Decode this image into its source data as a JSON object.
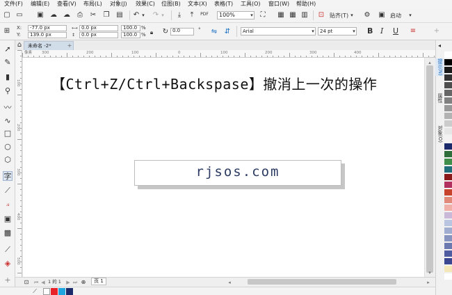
{
  "menubar": {
    "items": [
      "文件(F)",
      "编辑(E)",
      "查看(V)",
      "布局(L)",
      "对象(J)",
      "效果(C)",
      "位图(B)",
      "文本(X)",
      "表格(T)",
      "工具(O)",
      "窗口(W)",
      "帮助(H)"
    ]
  },
  "toolbar": {
    "zoom_value": "100%",
    "snap_label": "贴齐(T)",
    "launch_label": "启动"
  },
  "propbar": {
    "x_label": "X:",
    "x_value": "-77.0 px",
    "y_label": "Y:",
    "y_value": "139.0 px",
    "w_value": "0.0 px",
    "h_value": "0.0 px",
    "scale_w": "100.0",
    "scale_h": "100.0",
    "percent": "%",
    "rotation": "0.0",
    "degree": "°",
    "font_name": "Arial",
    "font_size": "24 pt",
    "bold": "B",
    "italic": "I",
    "underline": "U"
  },
  "document": {
    "tab_label": "未命名 -2*",
    "text_line": "【Ctrl+Z/Ctrl+Backspase】撤消上一次的操作",
    "box_text": "rjsos.com",
    "page_tab": "页 1",
    "page_counter": "1 的 1"
  },
  "ruler": {
    "units": "像素",
    "h_labels": [
      "300",
      "200",
      "100",
      "0",
      "100",
      "200",
      "300",
      "400"
    ],
    "v_labels": [
      "100",
      "200",
      "300",
      "400",
      "500"
    ]
  },
  "right_dock": {
    "tab1": "提示(N)",
    "tab2": "属性",
    "tab3": "对象(O)"
  },
  "colors": {
    "accent": "#1a6fc4",
    "doc_tab_bg": "#d2ddea",
    "box_text": "#2a3a62",
    "palette": [
      "#ffffff",
      "#000000",
      "#1a1a1a",
      "#333333",
      "#4d4d4d",
      "#666666",
      "#808080",
      "#999999",
      "#b3b3b3",
      "#cccccc",
      "#e6e6e6",
      "#f2f2f2",
      "#1b2a6b",
      "#2e6e3a",
      "#3f8f4a",
      "#1f6e7a",
      "#8a1a1a",
      "#b03060",
      "#c7432c",
      "#e28a7a",
      "#f0b0a8",
      "#c9b8d8",
      "#b8c4e0",
      "#a0acd0",
      "#8894c0",
      "#6c78b0",
      "#505ca0",
      "#3a4690",
      "#f4e8b8",
      "#ffffff"
    ],
    "status_swatches": [
      "#ffffff",
      "#e8212b",
      "#1fa6e0",
      "#1b2a6b"
    ]
  },
  "icons": {
    "menu_icons": [
      "new-icon",
      "open-icon",
      "save-icon",
      "undo-icon",
      "redo-icon",
      "import-icon",
      "export-icon",
      "pdf-icon"
    ]
  }
}
